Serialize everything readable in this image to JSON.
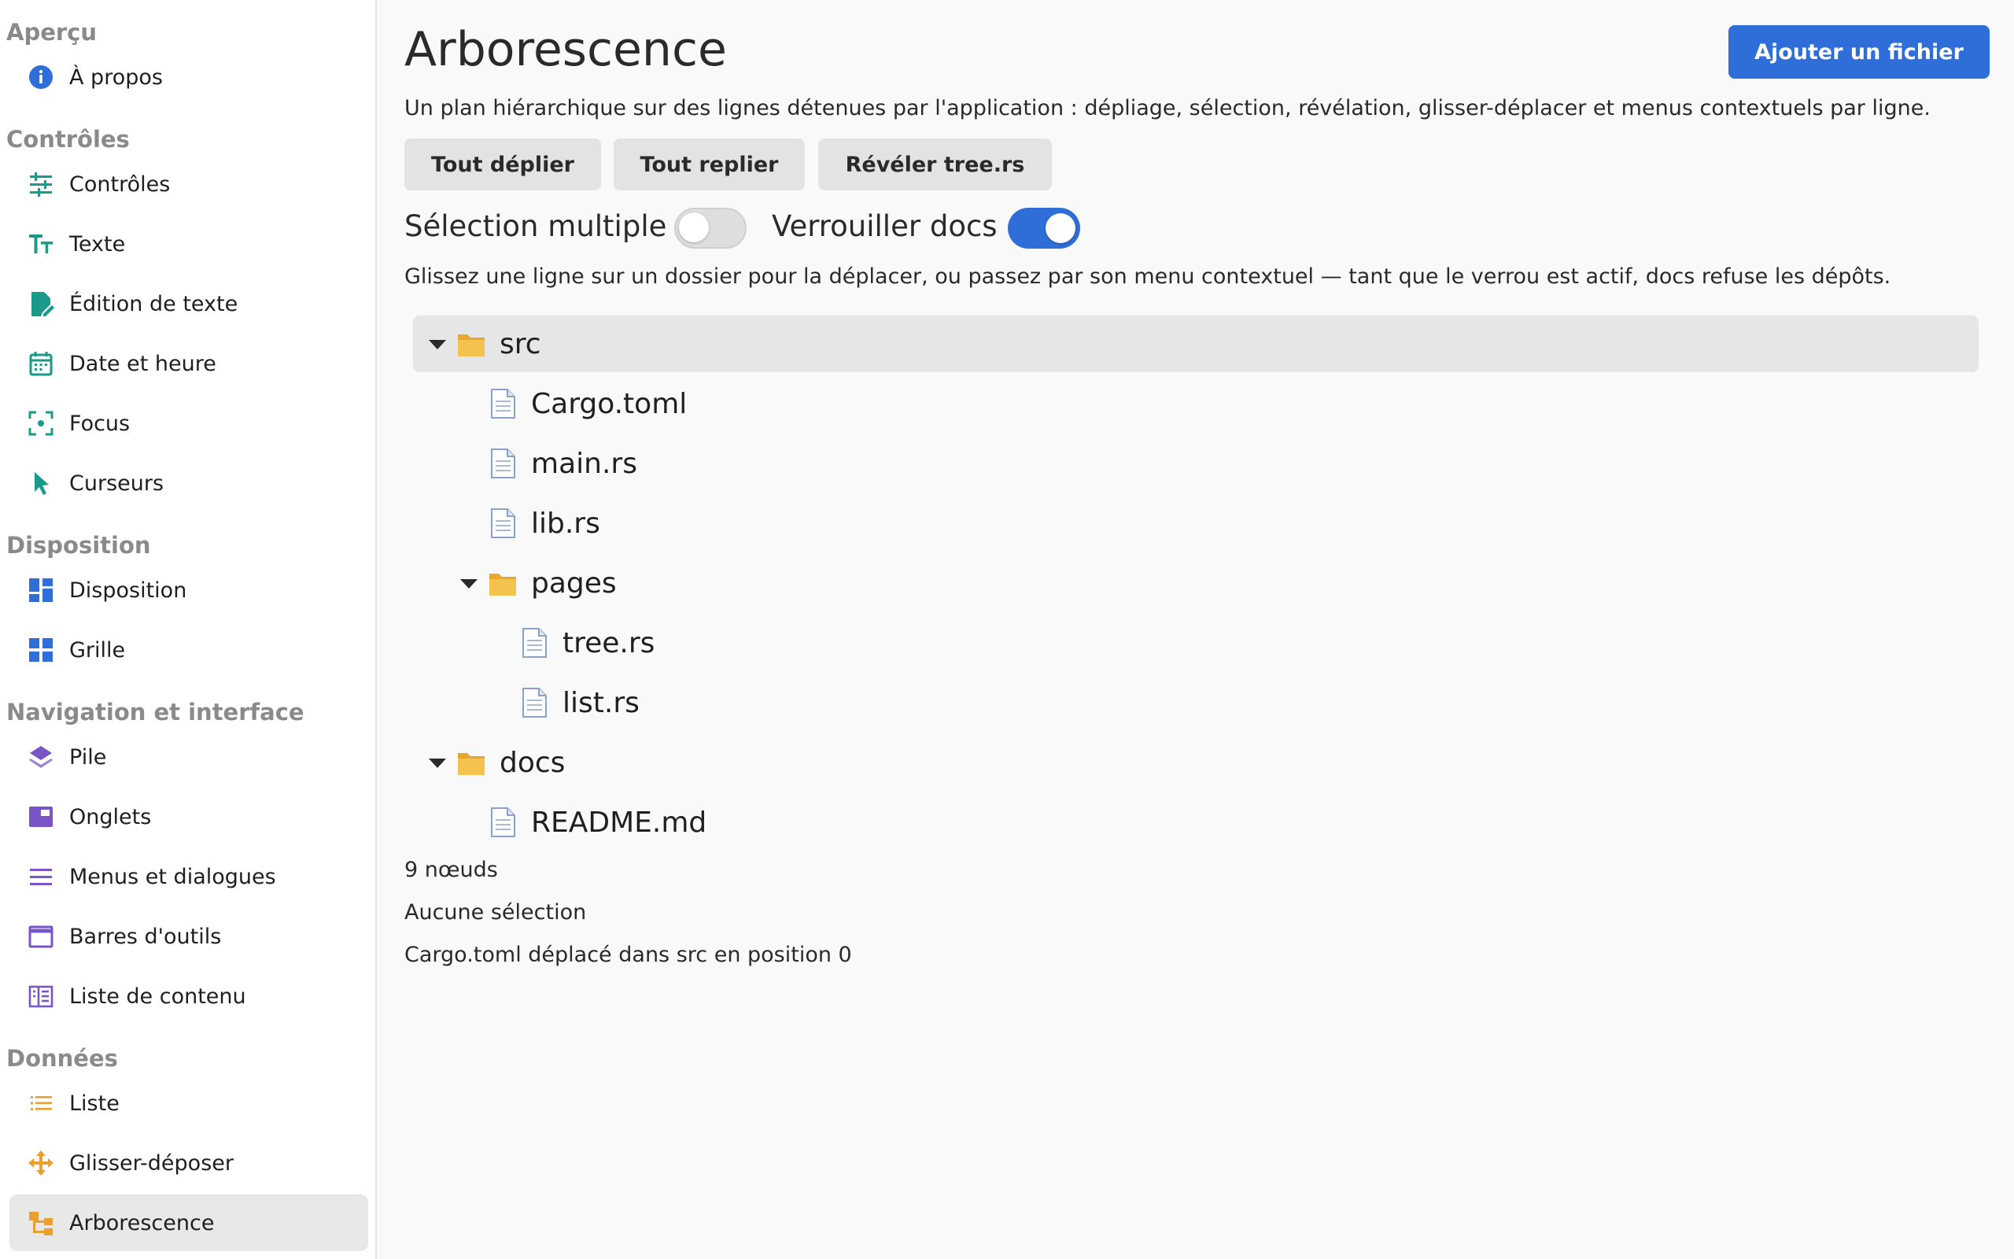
{
  "sidebar": {
    "sections": [
      {
        "title": "Aperçu",
        "items": [
          {
            "label": "À propos",
            "icon": "info-icon"
          }
        ]
      },
      {
        "title": "Contrôles",
        "items": [
          {
            "label": "Contrôles",
            "icon": "sliders-icon"
          },
          {
            "label": "Texte",
            "icon": "text-size-icon"
          },
          {
            "label": "Édition de texte",
            "icon": "edit-document-icon"
          },
          {
            "label": "Date et heure",
            "icon": "calendar-icon"
          },
          {
            "label": "Focus",
            "icon": "focus-target-icon"
          },
          {
            "label": "Curseurs",
            "icon": "cursor-pointer-icon"
          }
        ]
      },
      {
        "title": "Disposition",
        "items": [
          {
            "label": "Disposition",
            "icon": "dashboard-layout-icon"
          },
          {
            "label": "Grille",
            "icon": "grid-icon"
          }
        ]
      },
      {
        "title": "Navigation et interface",
        "items": [
          {
            "label": "Pile",
            "icon": "layers-icon"
          },
          {
            "label": "Onglets",
            "icon": "tabs-icon"
          },
          {
            "label": "Menus et dialogues",
            "icon": "menu-lines-icon"
          },
          {
            "label": "Barres d'outils",
            "icon": "window-toolbar-icon"
          },
          {
            "label": "Liste de contenu",
            "icon": "content-list-icon"
          }
        ]
      },
      {
        "title": "Données",
        "items": [
          {
            "label": "Liste",
            "icon": "bullet-list-icon"
          },
          {
            "label": "Glisser-déposer",
            "icon": "move-arrows-icon"
          },
          {
            "label": "Arborescence",
            "icon": "tree-structure-icon",
            "active": true
          }
        ]
      }
    ]
  },
  "colors": {
    "accent": "#2f6ed8",
    "controls_icons": "#1a9a8a",
    "layout_icons": "#2f6ed8",
    "navigation_icons": "#7a55c8",
    "data_icons": "#e8a030",
    "folder": "#f0b840"
  },
  "main": {
    "title": "Arborescence",
    "add_button": "Ajouter un fichier",
    "description": "Un plan hiérarchique sur des lignes détenues par l'application : dépliage, sélection, révélation, glisser-déplacer et menus contextuels par ligne.",
    "toolbar": {
      "expand_all": "Tout déplier",
      "collapse_all": "Tout replier",
      "reveal": "Révéler tree.rs"
    },
    "toggles": {
      "multi_select_label": "Sélection multiple",
      "multi_select_on": false,
      "lock_docs_label": "Verrouiller docs",
      "lock_docs_on": true
    },
    "hint": "Glissez une ligne sur un dossier pour la déplacer, ou passez par son menu contextuel — tant que le verrou est actif, docs refuse les dépôts.",
    "tree": [
      {
        "label": "src",
        "type": "folder",
        "depth": 0,
        "expanded": true,
        "selected": true
      },
      {
        "label": "Cargo.toml",
        "type": "file",
        "depth": 1
      },
      {
        "label": "main.rs",
        "type": "file",
        "depth": 1
      },
      {
        "label": "lib.rs",
        "type": "file",
        "depth": 1
      },
      {
        "label": "pages",
        "type": "folder",
        "depth": 1,
        "expanded": true
      },
      {
        "label": "tree.rs",
        "type": "file",
        "depth": 2
      },
      {
        "label": "list.rs",
        "type": "file",
        "depth": 2
      },
      {
        "label": "docs",
        "type": "folder",
        "depth": 0,
        "expanded": true
      },
      {
        "label": "README.md",
        "type": "file",
        "depth": 1
      }
    ],
    "status": {
      "node_count": "9 nœuds",
      "selection": "Aucune sélection",
      "last_action": "Cargo.toml déplacé dans src en position 0"
    }
  }
}
